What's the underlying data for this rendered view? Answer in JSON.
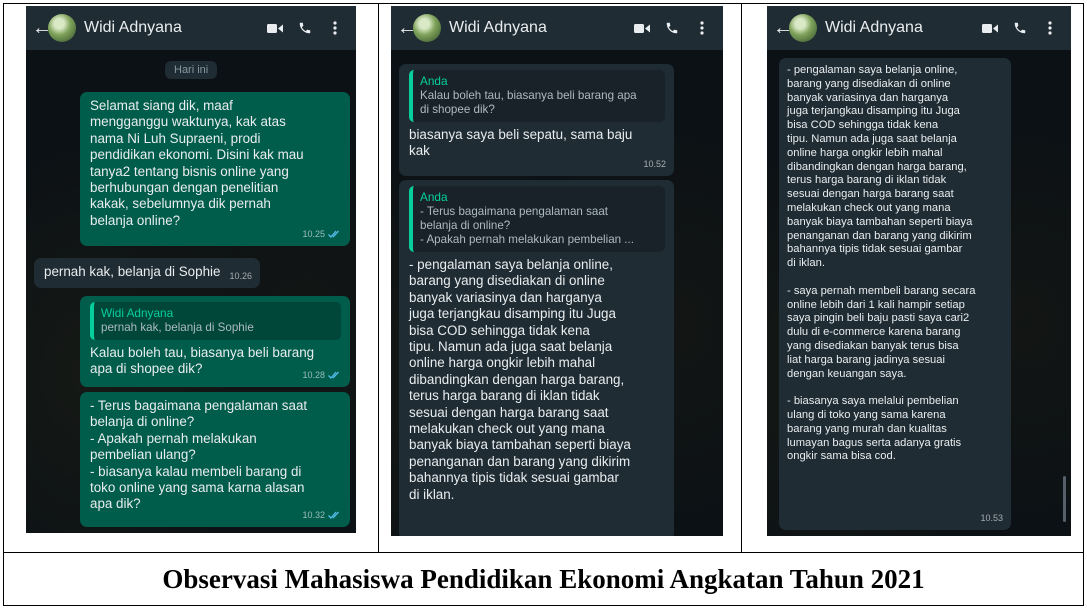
{
  "caption": "Observasi Mahasiswa Pendidikan Ekonomi Angkatan Tahun 2021",
  "colors": {
    "appbar": "#1f2c34",
    "outgoing_bubble": "#005c4b",
    "incoming_bubble": "#1f2c34",
    "quote_accent": "#06cf9c",
    "read_ticks": "#53bdeb",
    "wallpaper": "#0c1115"
  },
  "icons": {
    "back": "back-arrow-icon",
    "video": "video-call-icon",
    "call": "phone-call-icon",
    "menu": "more-vert-icon"
  },
  "contact_name": "Widi Adnyana",
  "panel1": {
    "day_chip": "Hari ini",
    "msg1": {
      "text": "Selamat siang dik, maaf\nmengganggu waktunya, kak atas\nnama Ni Luh Supraeni, prodi\npendidikan ekonomi. Disini kak mau\ntanya2 tentang bisnis online yang\nberhubungan dengan penelitian\nkakak, sebelumnya dik pernah\nbelanja online?",
      "time": "10.25"
    },
    "msg2": {
      "text": "pernah kak, belanja di Sophie",
      "time": "10.26"
    },
    "msg3": {
      "quote_name": "Widi Adnyana",
      "quote_text": "pernah kak, belanja di Sophie",
      "text": "Kalau boleh tau, biasanya beli barang\napa di shopee dik?",
      "time": "10.28"
    },
    "msg4": {
      "text": "- Terus bagaimana pengalaman saat\nbelanja di online?\n- Apakah pernah melakukan\npembelian ulang?\n- biasanya kalau membeli barang di\ntoko online yang sama karna alasan\napa dik?",
      "time": "10.32"
    }
  },
  "panel2": {
    "msg1": {
      "quote_name": "Anda",
      "quote_text": "Kalau boleh tau, biasanya beli barang apa\ndi shopee dik?",
      "text": "biasanya saya beli sepatu, sama baju\nkak",
      "time": "10.52"
    },
    "msg2": {
      "quote_name": "Anda",
      "quote_line1": "- Terus bagaimana pengalaman saat",
      "quote_line2": "belanja di online?",
      "quote_line3": "- Apakah pernah melakukan pembelian ...",
      "text": "- pengalaman saya belanja online,\nbarang yang disediakan di online\nbanyak variasinya dan harganya\njuga terjangkau disamping itu Juga\nbisa COD sehingga tidak kena\ntipu. Namun ada juga saat belanja\nonline harga   ongkir lebih mahal\ndibandingkan dengan harga barang,\nterus harga barang di iklan tidak\nsesuai dengan harga barang saat\nmelakukan check out yang mana\nbanyak biaya tambahan seperti biaya\npenanganan dan barang yang dikirim\nbahannya tipis tidak sesuai gambar\ndi iklan."
    }
  },
  "panel3": {
    "msg1": {
      "text": "- pengalaman saya belanja online,\nbarang yang disediakan di online\nbanyak variasinya dan harganya\njuga terjangkau disamping itu Juga\nbisa COD sehingga tidak kena\ntipu. Namun ada juga saat belanja\nonline harga   ongkir lebih mahal\ndibandingkan dengan harga barang,\nterus harga barang di iklan tidak\nsesuai dengan harga barang saat\nmelakukan check out yang mana\nbanyak biaya tambahan seperti biaya\npenanganan dan barang yang dikirim\nbahannya tipis tidak sesuai gambar\ndi iklan.\n\n- saya pernah membeli barang secara\nonline lebih dari 1 kali hampir setiap\nsaya pingin beli baju pasti saya cari2\ndulu di e-commerce karena barang\nyang disediakan banyak terus bisa\nliat harga barang jadinya sesuai\ndengan keuangan saya.\n\n- biasanya saya melalui pembelian\nulang di toko yang sama karena\nbarang yang murah dan kualitas\nlumayan bagus serta adanya gratis\nongkir sama bisa cod.",
      "time": "10.53"
    }
  }
}
